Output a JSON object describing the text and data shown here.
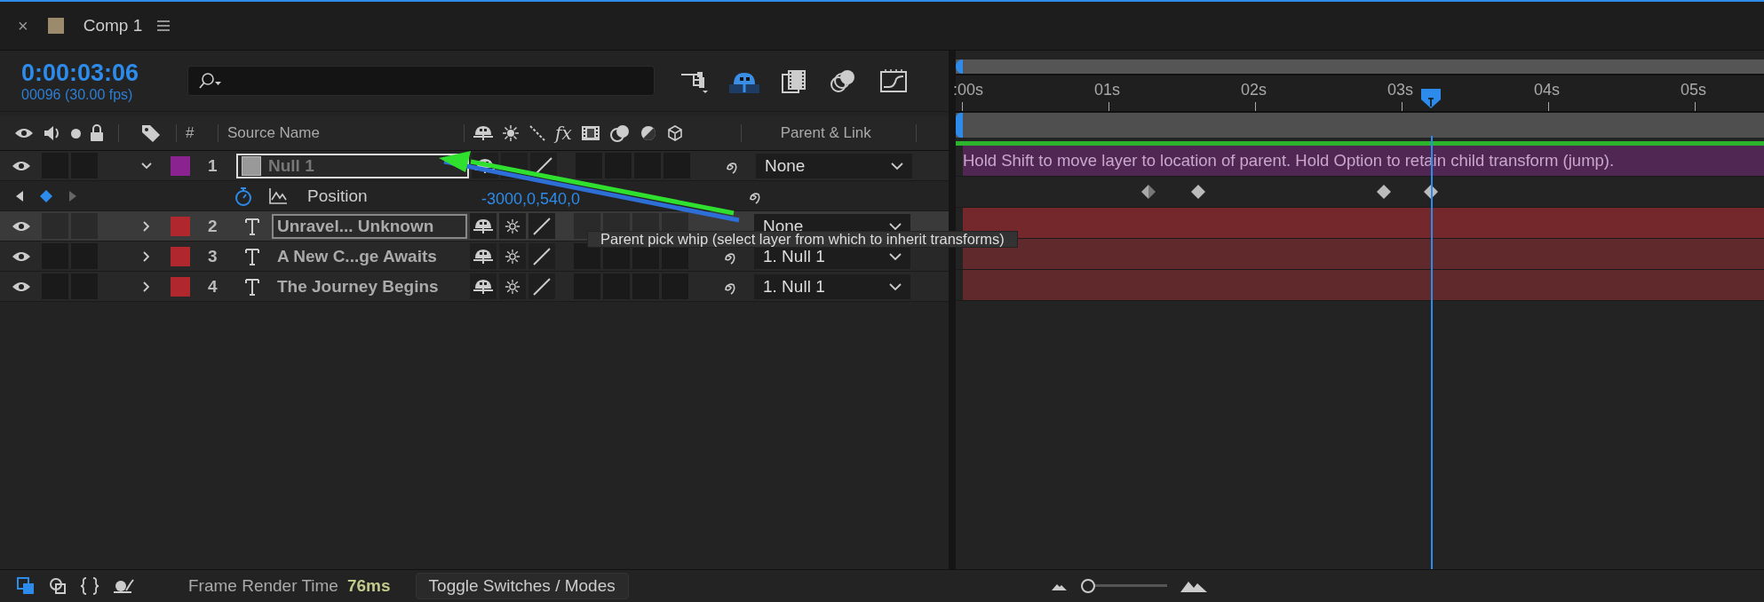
{
  "tab": {
    "close": "×",
    "title": "Comp 1"
  },
  "time": {
    "timecode": "0:00:03:06",
    "frames": "00096 (30.00 fps)"
  },
  "columns": {
    "effects": "fx",
    "number": "#",
    "source_name": "Source Name",
    "parent": "Parent & Link"
  },
  "layers": [
    {
      "number": "1",
      "name": "Null 1",
      "kind": "null",
      "color": "#8a2290",
      "expanded": true,
      "selected": false,
      "targeted": true,
      "parent": "None",
      "bar_message": "Hold Shift to move layer to location of parent. Hold Option to retain child transform (jump)."
    },
    {
      "number": "2",
      "name": "Unravel... Unknown",
      "kind": "text",
      "color": "#b0272d",
      "expanded": false,
      "selected": true,
      "targeted": false,
      "parent": "None"
    },
    {
      "number": "3",
      "name": "A New C...ge Awaits",
      "kind": "text",
      "color": "#b0272d",
      "expanded": false,
      "selected": false,
      "targeted": false,
      "parent": "1. Null 1"
    },
    {
      "number": "4",
      "name": "The Journey Begins",
      "kind": "text",
      "color": "#b0272d",
      "expanded": false,
      "selected": false,
      "targeted": false,
      "parent": "1. Null 1"
    }
  ],
  "property": {
    "name": "Position",
    "value": "-3000,0,540,0",
    "keyframes": [
      {
        "kind": "split"
      },
      {
        "kind": "full"
      },
      {
        "kind": "full"
      },
      {
        "kind": "full"
      }
    ]
  },
  "tooltip": "Parent pick whip (select layer from which to inherit transforms)",
  "ruler": [
    ":00s",
    "01s",
    "02s",
    "03s",
    "04s",
    "05s"
  ],
  "status": {
    "label": "Frame Render Time",
    "value": "76ms",
    "toggle": "Toggle Switches / Modes"
  },
  "zoom": {
    "level": 0.08
  }
}
